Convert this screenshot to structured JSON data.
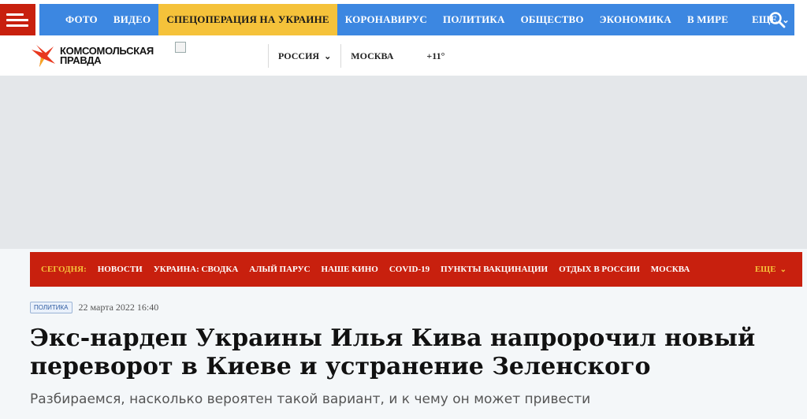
{
  "main_nav": {
    "items": [
      "ФОТО",
      "ВИДЕО",
      "СПЕЦОПЕРАЦИЯ НА УКРАИНЕ",
      "КОРОНАВИРУС",
      "ПОЛИТИКА",
      "ОБЩЕСТВО",
      "ЭКОНОМИКА",
      "В МИРЕ"
    ],
    "more_label": "ЕЩЕ",
    "highlight_color": "#f5c23a",
    "bg_color": "#3c87e1"
  },
  "logo": {
    "line1": "КОМСОМОЛЬСКАЯ",
    "line2": "ПРАВДА"
  },
  "region": {
    "label": "РОССИЯ",
    "city": "МОСКВА",
    "weather": "+11°"
  },
  "today_bar": {
    "label": "СЕГОДНЯ:",
    "items": [
      "НОВОСТИ",
      "УКРАИНА: СВОДКА",
      "АЛЫЙ ПАРУС",
      "НАШЕ КИНО",
      "COVID-19",
      "ПУНКТЫ ВАКЦИНАЦИИ",
      "ОТДЫХ В РОССИИ",
      "МОСКВА"
    ],
    "more_label": "ЕЩЕ",
    "bg_color": "#c8200e"
  },
  "article": {
    "rubric": "ПОЛИТИКА",
    "date": "22 марта 2022 16:40",
    "title_line1": "Экс-нардеп Украины Илья Кива напророчил новый",
    "title_line2": "переворот в Киеве и устранение Зеленского",
    "subtitle": "Разбираемся, насколько вероятен такой вариант, и к чему он может привести"
  }
}
